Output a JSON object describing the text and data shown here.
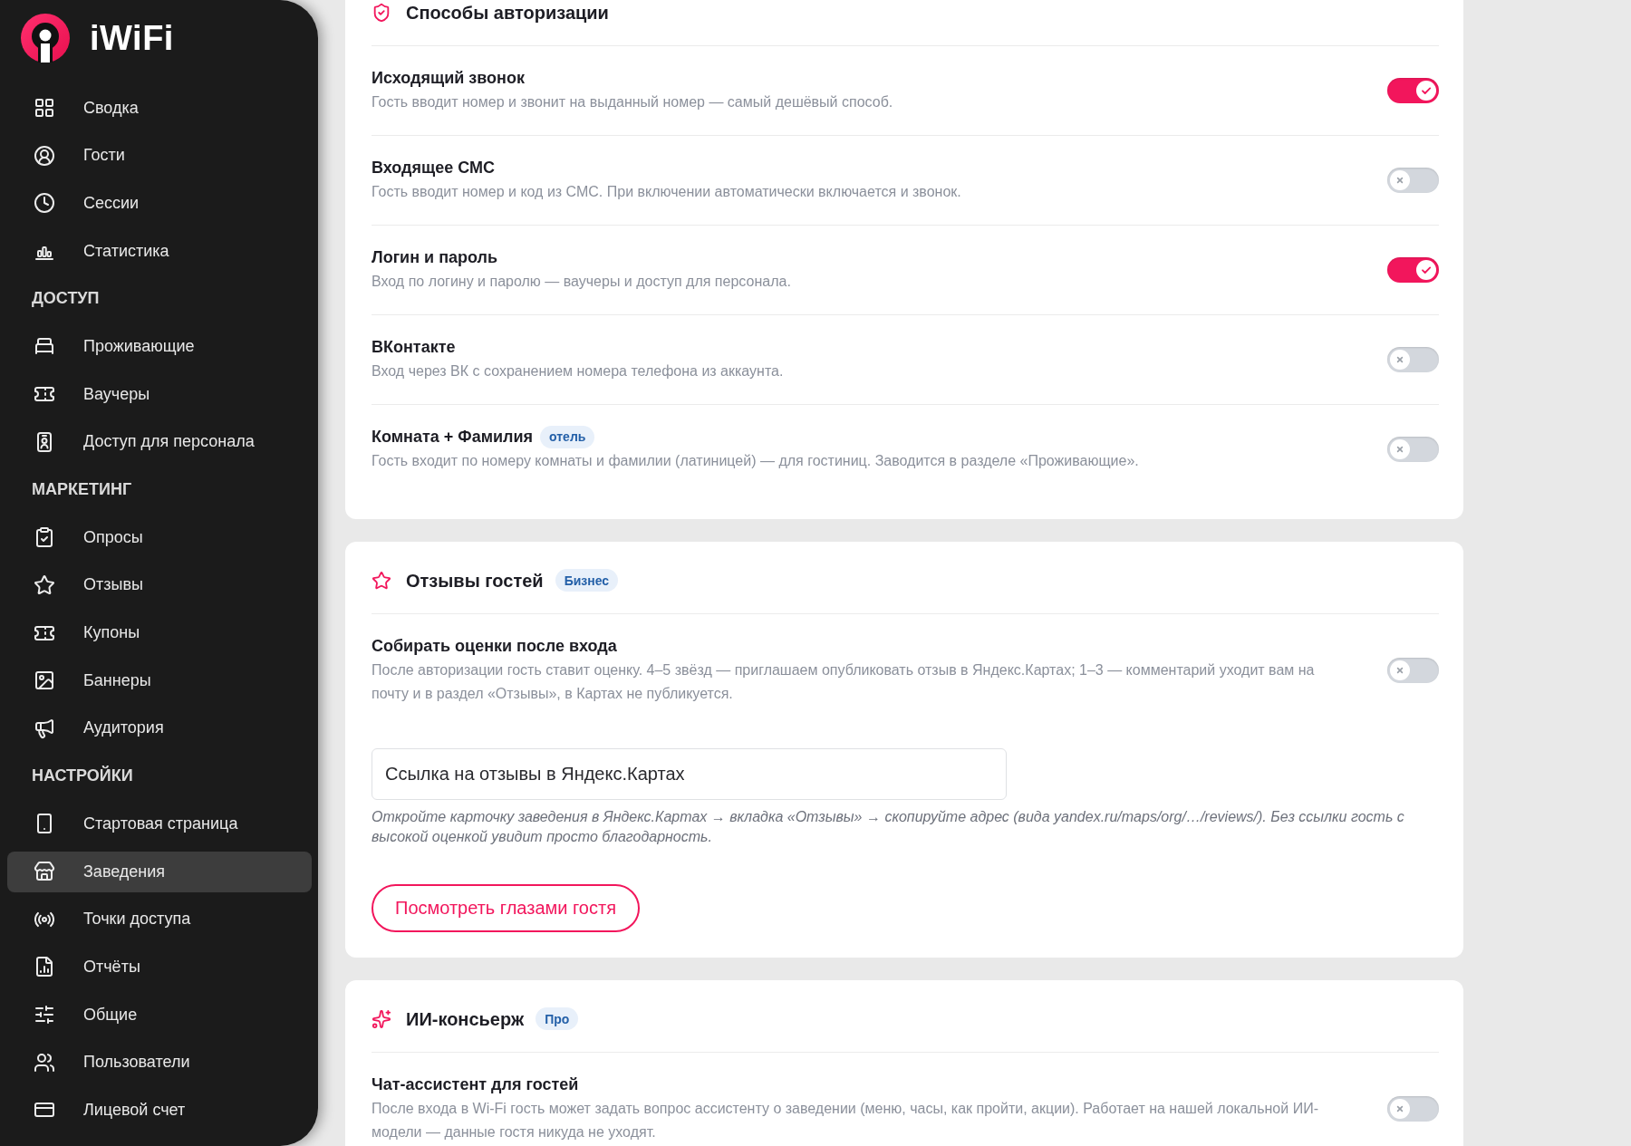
{
  "sidebar": {
    "brand": "iWiFi",
    "items": [
      {
        "label": "Сводка",
        "selected": false
      },
      {
        "label": "Гости",
        "selected": false
      },
      {
        "label": "Сессии",
        "selected": false
      },
      {
        "label": "Статистика",
        "selected": false
      }
    ],
    "sections": [
      {
        "title": "ДОСТУП",
        "items": [
          {
            "label": "Проживающие",
            "selected": false
          },
          {
            "label": "Ваучеры",
            "selected": false
          },
          {
            "label": "Доступ для персонала",
            "selected": false
          }
        ]
      },
      {
        "title": "МАРКЕТИНГ",
        "items": [
          {
            "label": "Опросы",
            "selected": false
          },
          {
            "label": "Отзывы",
            "selected": false
          },
          {
            "label": "Купоны",
            "selected": false
          },
          {
            "label": "Баннеры",
            "selected": false
          },
          {
            "label": "Аудитория",
            "selected": false
          }
        ]
      },
      {
        "title": "НАСТРОЙКИ",
        "items": [
          {
            "label": "Стартовая страница",
            "selected": false
          },
          {
            "label": "Заведения",
            "selected": true
          },
          {
            "label": "Точки доступа",
            "selected": false
          },
          {
            "label": "Отчёты",
            "selected": false
          },
          {
            "label": "Общие",
            "selected": false
          },
          {
            "label": "Пользователи",
            "selected": false
          },
          {
            "label": "Лицевой счет",
            "selected": false
          }
        ]
      }
    ]
  },
  "cards": [
    {
      "title": "Способы авторизации",
      "options": [
        {
          "title": "Исходящий звонок",
          "description": "Гость вводит номер и звонит на выданный номер — самый дешёвый способ.",
          "on": true
        },
        {
          "title": "Входящее СМС",
          "description": "Гость вводит номер и код из СМС. При включении автоматически включается и звонок.",
          "on": false
        },
        {
          "title": "Логин и пароль",
          "description": "Вход по логину и паролю — ваучеры и доступ для персонала.",
          "on": true
        },
        {
          "title": "ВКонтакте",
          "description": "Вход через ВК с сохранением номера телефона из аккаунта.",
          "on": false
        },
        {
          "title": "Комната + Фамилия",
          "badge": "отель",
          "description": "Гость входит по номеру комнаты и фамилии (латиницей) — для гостиниц. Заводится в разделе «Проживающие».",
          "on": false
        }
      ]
    },
    {
      "title": "Отзывы гостей",
      "badge": "Бизнес",
      "options": [
        {
          "title": "Собирать оценки после входа",
          "description": "После авторизации гость ставит оценку. 4–5 звёзд — приглашаем опубликовать отзыв в Яндекс.Картах; 1–3 — комментарий уходит вам на почту и в раздел «Отзывы», в Картах не публикуется.",
          "on": false
        }
      ],
      "field": {
        "placeholder": "Ссылка на отзывы в Яндекс.Картах"
      },
      "hint": "Откройте карточку заведения в Яндекс.Картах → вкладка «Отзывы» → скопируйте адрес (вида yandex.ru/maps/org/…/reviews/). Без ссылки гость с высокой оценкой увидит просто благодарность.",
      "button": "Посмотреть глазами гостя"
    },
    {
      "title": "ИИ-консьерж",
      "badge": "Про",
      "options": [
        {
          "title": "Чат-ассистент для гостей",
          "description": "После входа в Wi-Fi гость может задать вопрос ассистенту о заведении (меню, часы, как пройти, акции). Работает на нашей локальной ИИ-модели — данные гостя никуда не уходят.",
          "on": false
        }
      ]
    }
  ]
}
